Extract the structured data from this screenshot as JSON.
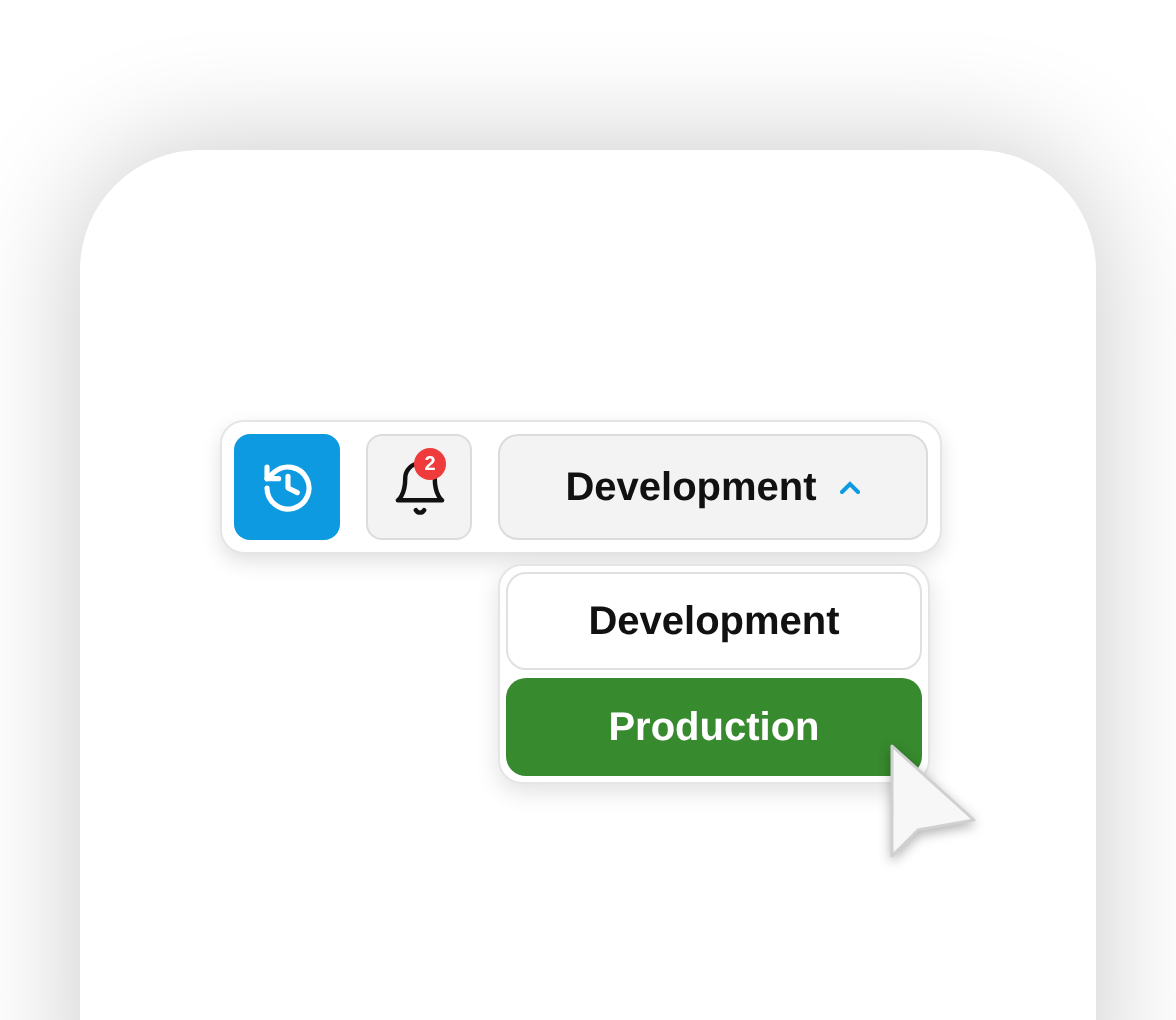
{
  "toolbar": {
    "history_button": {
      "active": true
    },
    "notifications": {
      "badge": "2"
    },
    "environment_select": {
      "value": "Development",
      "expanded": true
    }
  },
  "menu": {
    "items": [
      {
        "label": "Development",
        "highlighted": false
      },
      {
        "label": "Production",
        "highlighted": true
      }
    ]
  }
}
